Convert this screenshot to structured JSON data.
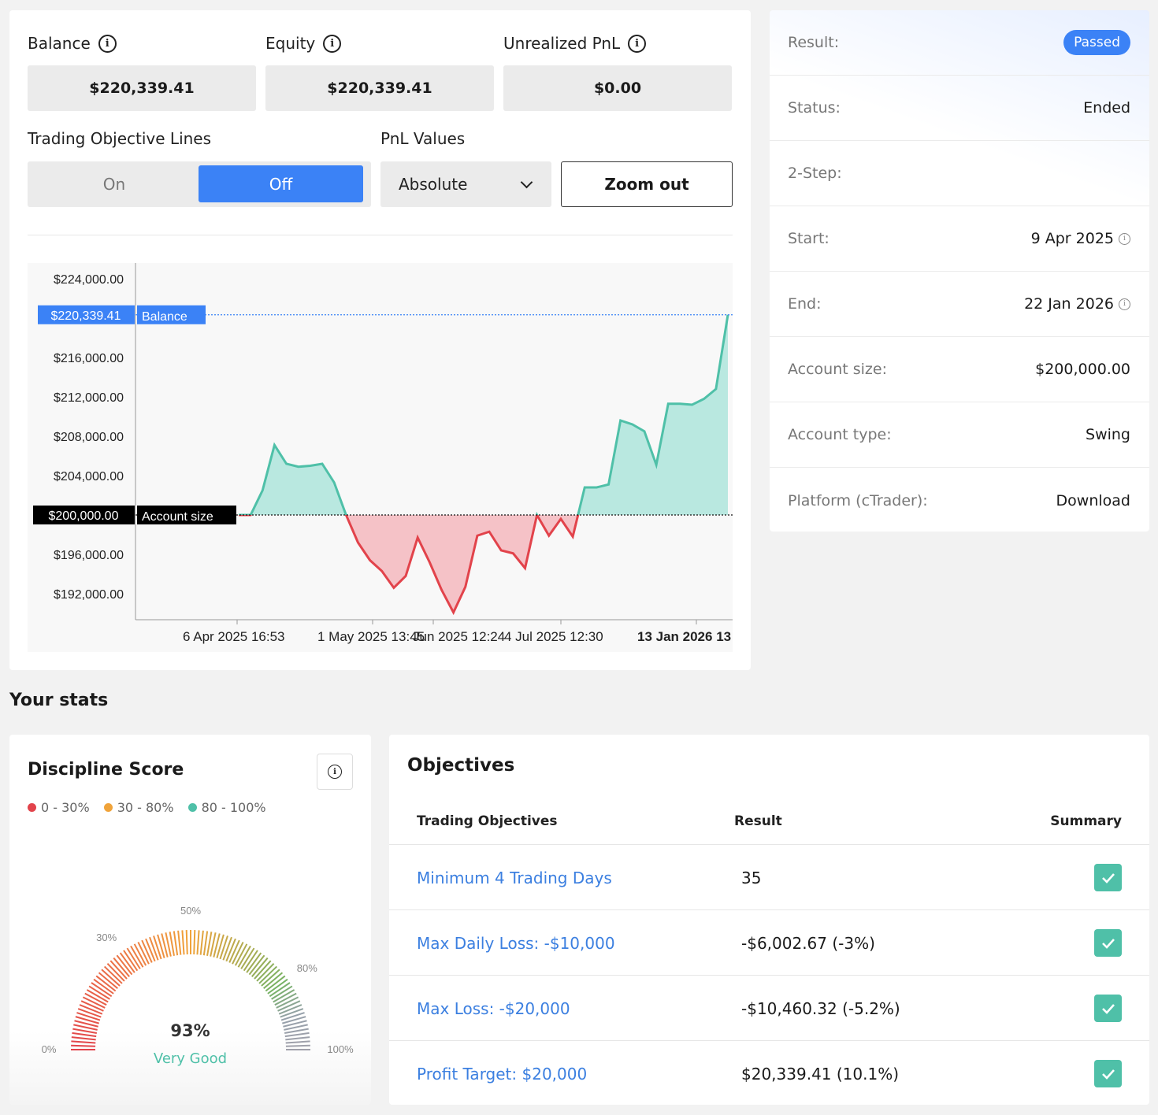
{
  "kpis": {
    "balance_label": "Balance",
    "balance_value": "$220,339.41",
    "equity_label": "Equity",
    "equity_value": "$220,339.41",
    "unrealized_label": "Unrealized PnL",
    "unrealized_value": "$0.00"
  },
  "controls": {
    "objective_lines_label": "Trading Objective Lines",
    "toggle_on": "On",
    "toggle_off": "Off",
    "toggle_selected": "Off",
    "pnl_label": "PnL Values",
    "pnl_select_value": "Absolute",
    "zoom_out": "Zoom out"
  },
  "chart_data": {
    "type": "area",
    "ylim": [
      188000,
      226000
    ],
    "y_ticks": [
      {
        "label": "$224,000.00",
        "value": 224000
      },
      {
        "label": "$216,000.00",
        "value": 216000
      },
      {
        "label": "$212,000.00",
        "value": 212000
      },
      {
        "label": "$208,000.00",
        "value": 208000
      },
      {
        "label": "$204,000.00",
        "value": 204000
      },
      {
        "label": "$196,000.00",
        "value": 196000
      },
      {
        "label": "$192,000.00",
        "value": 192000
      }
    ],
    "x_ticks": [
      "6 Apr 2025 16:53",
      "1 May 2025 13:45",
      "Jun 2025 12:24",
      "4 Jul 2025 12:30",
      "13 Jan 2026 13"
    ],
    "baseline": {
      "label": "Account size",
      "value_label": "$200,000.00",
      "value": 200000
    },
    "balance_marker": {
      "label": "Balance",
      "value_label": "$220,339.41",
      "value": 220339.41
    },
    "series": [
      {
        "values": [
          200000,
          200000,
          202500,
          207100,
          205200,
          204900,
          205000,
          205200,
          203300,
          200000,
          197200,
          195400,
          194300,
          192600,
          193800,
          197700,
          195200,
          192400,
          190100,
          192700,
          197900,
          198300,
          196400,
          196100,
          194600,
          200000,
          197900,
          199600,
          197800,
          202800,
          202800,
          203100,
          209600,
          209200,
          208500,
          205100,
          211300,
          211300,
          211200,
          211800,
          212800,
          220339.41
        ],
        "name": "Balance"
      }
    ]
  },
  "info": {
    "rows": [
      {
        "key": "Result:",
        "value": "Passed",
        "badge": true
      },
      {
        "key": "Status:",
        "value": "Ended"
      },
      {
        "key": "2-Step:",
        "value": ""
      },
      {
        "key": "Start:",
        "value": "9 Apr 2025",
        "info": true
      },
      {
        "key": "End:",
        "value": "22 Jan 2026",
        "info": true
      },
      {
        "key": "Account size:",
        "value": "$200,000.00"
      },
      {
        "key": "Account type:",
        "value": "Swing"
      },
      {
        "key": "Platform (cTrader):",
        "value": "Download"
      }
    ]
  },
  "stats": {
    "title": "Your stats",
    "discipline": {
      "title": "Discipline Score",
      "legend": [
        {
          "label": "0 - 30%",
          "color": "#e2434b"
        },
        {
          "label": "30 - 80%",
          "color": "#f0a33a"
        },
        {
          "label": "80 - 100%",
          "color": "#4fc0a8"
        }
      ],
      "gauge_labels": {
        "p0": "0%",
        "p30": "30%",
        "p50": "50%",
        "p80": "80%",
        "p100": "100%"
      },
      "score": "93%",
      "score_value": 93,
      "rating": "Very Good"
    }
  },
  "objectives": {
    "title": "Objectives",
    "headers": {
      "name": "Trading Objectives",
      "result": "Result",
      "summary": "Summary"
    },
    "rows": [
      {
        "name": "Minimum 4 Trading Days",
        "result": "35",
        "passed": true
      },
      {
        "name": "Max Daily Loss: -$10,000",
        "result": "-$6,002.67 (-3%)",
        "passed": true
      },
      {
        "name": "Max Loss: -$20,000",
        "result": "-$10,460.32 (-5.2%)",
        "passed": true
      },
      {
        "name": "Profit Target: $20,000",
        "result": "$20,339.41 (10.1%)",
        "passed": true
      }
    ]
  },
  "colors": {
    "accent": "#3b82f6",
    "profit": "#4fc0a8",
    "loss": "#e2434b",
    "link": "#3b7fe0"
  }
}
